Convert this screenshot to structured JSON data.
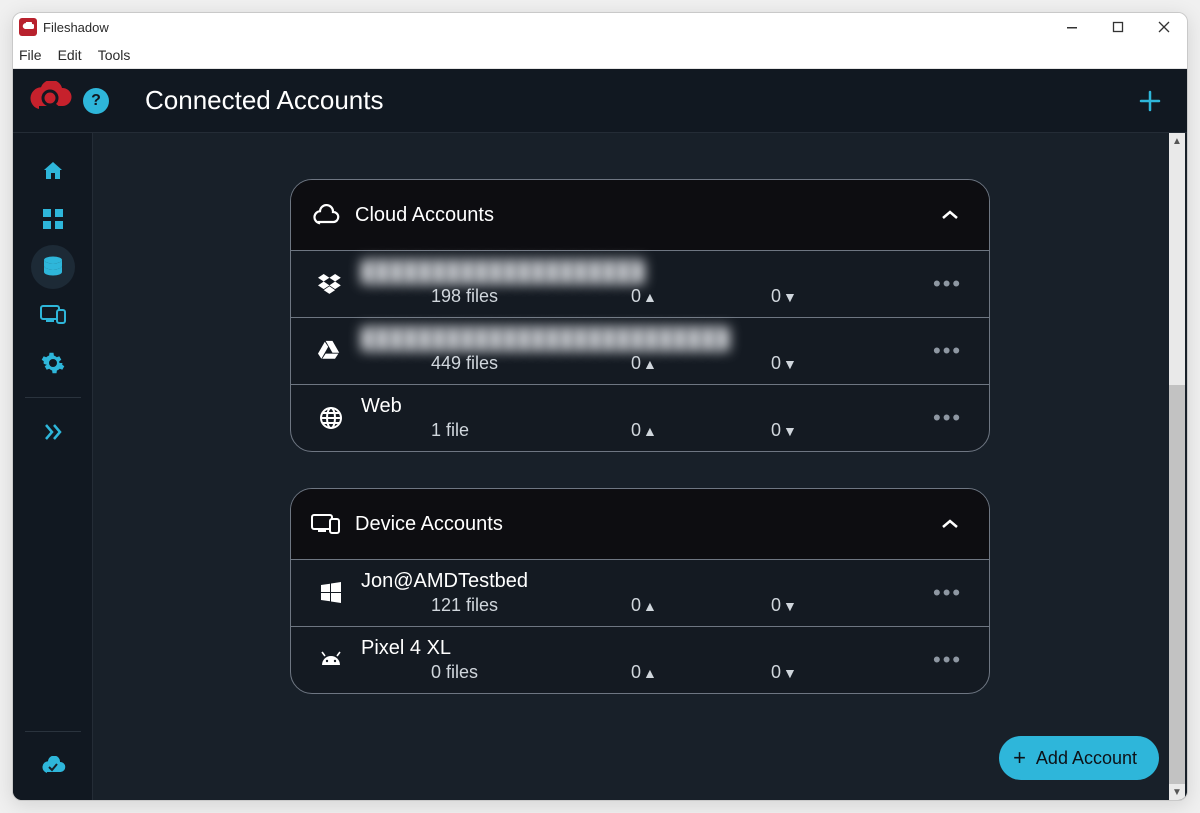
{
  "window": {
    "title": "Fileshadow"
  },
  "menu": {
    "file": "File",
    "edit": "Edit",
    "tools": "Tools"
  },
  "header": {
    "title": "Connected Accounts",
    "help_glyph": "?"
  },
  "fab": {
    "label": "Add Account"
  },
  "sections": {
    "cloud": {
      "title": "Cloud Accounts",
      "accounts": [
        {
          "icon": "dropbox",
          "name": "████████████████████",
          "blurred": true,
          "files_label": "198 files",
          "up_label": "0",
          "down_label": "0"
        },
        {
          "icon": "gdrive",
          "name": "██████████████████████████",
          "blurred": true,
          "files_label": "449 files",
          "up_label": "0",
          "down_label": "0"
        },
        {
          "icon": "globe",
          "name": "Web",
          "blurred": false,
          "files_label": "1 file",
          "up_label": "0",
          "down_label": "0"
        }
      ]
    },
    "device": {
      "title": "Device Accounts",
      "accounts": [
        {
          "icon": "windows",
          "name": "Jon@AMDTestbed",
          "blurred": false,
          "files_label": "121 files",
          "up_label": "0",
          "down_label": "0"
        },
        {
          "icon": "android",
          "name": "Pixel 4 XL",
          "blurred": false,
          "files_label": "0 files",
          "up_label": "0",
          "down_label": "0"
        }
      ]
    }
  }
}
